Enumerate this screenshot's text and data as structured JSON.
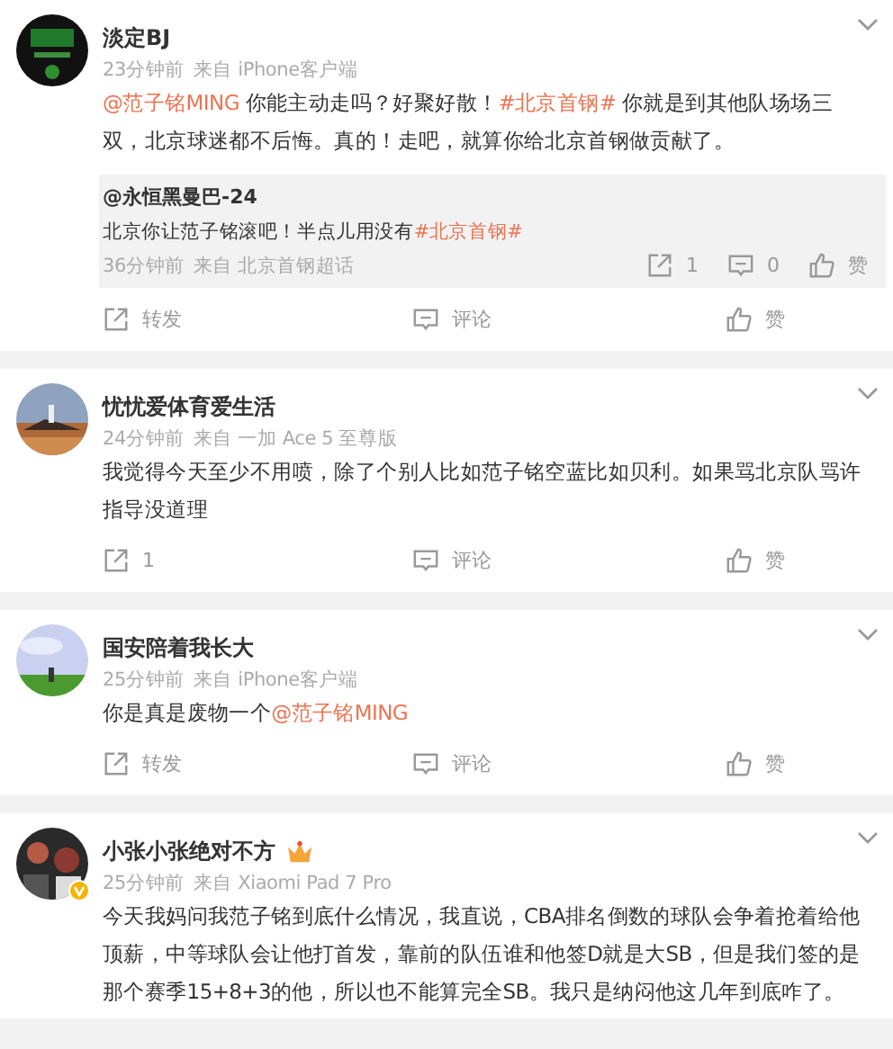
{
  "comments": [
    {
      "name": "淡定BJ",
      "crown": false,
      "verified": false,
      "time": "23分钟前",
      "source": "来自 iPhone客户端",
      "text": [
        {
          "kind": "link",
          "text": "@范子铭MING"
        },
        {
          "kind": "text",
          "text": " 你能主动走吗？好聚好散！"
        },
        {
          "kind": "link",
          "text": "#北京首钢#"
        },
        {
          "kind": "text",
          "text": " 你就是到其他队场场三双，北京球迷都不后悔。真的！走吧，就算你给北京首钢做贡献了。"
        }
      ],
      "reply": {
        "name": "@永恒黑曼巴-24",
        "text": [
          {
            "kind": "text",
            "text": "北京你让范子铭滚吧！半点儿用没有"
          },
          {
            "kind": "link",
            "text": "#北京首钢#"
          }
        ],
        "time": "36分钟前",
        "source": "来自 北京首钢超话",
        "repost": "1",
        "comment": "0",
        "like": "赞"
      },
      "actions": {
        "repost": "转发",
        "comment": "评论",
        "like": "赞"
      }
    },
    {
      "name": "忧忧爱体育爱生活",
      "crown": false,
      "verified": false,
      "time": "24分钟前",
      "source": "来自 一加 Ace 5 至尊版",
      "text": [
        {
          "kind": "text",
          "text": "我觉得今天至少不用喷，除了个别人比如范子铭空蓝比如贝利。如果骂北京队骂许指导没道理"
        }
      ],
      "actions": {
        "repost": "1",
        "comment": "评论",
        "like": "赞"
      }
    },
    {
      "name": "国安陪着我长大",
      "crown": false,
      "verified": false,
      "time": "25分钟前",
      "source": "来自 iPhone客户端",
      "text": [
        {
          "kind": "text",
          "text": "你是真是废物一个"
        },
        {
          "kind": "link",
          "text": "@范子铭MING"
        }
      ],
      "actions": {
        "repost": "转发",
        "comment": "评论",
        "like": "赞"
      }
    },
    {
      "name": "小张小张绝对不方",
      "crown": true,
      "verified": true,
      "time": "25分钟前",
      "source": "来自 Xiaomi Pad 7 Pro",
      "text": [
        {
          "kind": "text",
          "text": "今天我妈问我范子铭到底什么情况，我直说，CBA排名倒数的球队会争着抢着给他顶薪，中等球队会让他打首发，靠前的队伍谁和他签D就是大SB，但是我们签的是那个赛季15+8+3的他，所以也不能算完全SB。我只是纳闷他这几年到底咋了。"
        }
      ]
    }
  ]
}
